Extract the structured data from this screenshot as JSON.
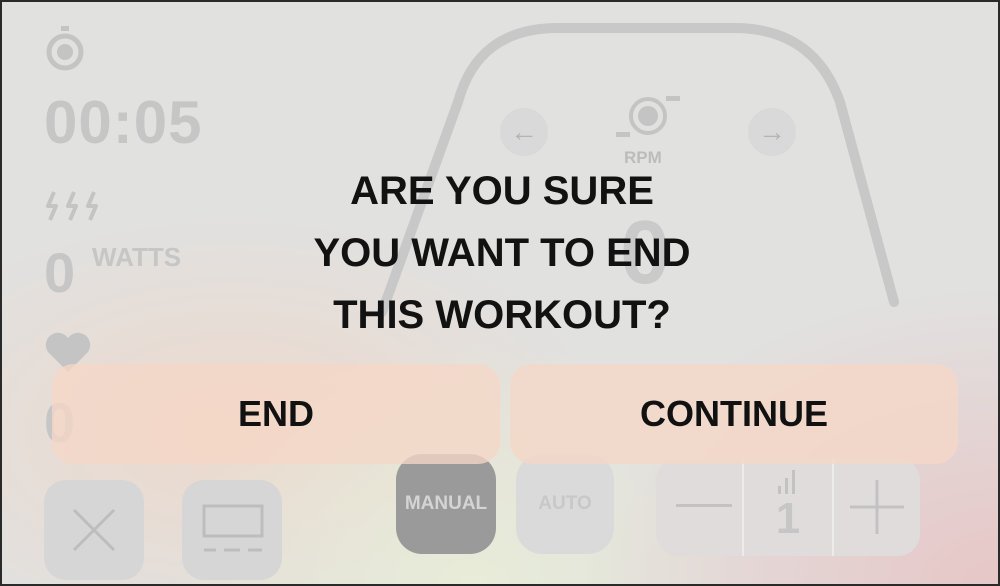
{
  "stats": {
    "elapsed_time": "00:05",
    "watts_value": "0",
    "watts_unit": "WATTS",
    "heart_rate_value": "0"
  },
  "cadence": {
    "label": "RPM",
    "value": "0"
  },
  "modes": {
    "manual": "MANUAL",
    "auto": "AUTO"
  },
  "resistance": {
    "level": "1"
  },
  "dialog": {
    "message_lines": [
      "ARE YOU SURE",
      "YOU WANT TO END",
      "THIS WORKOUT?"
    ],
    "end_label": "END",
    "continue_label": "CONTINUE"
  },
  "colors": {
    "dialog_button": "#f5d7c6",
    "dimmed_text": "#c6c6c6",
    "manual_active": "#9a9a9a"
  },
  "icons": [
    "stopwatch-icon",
    "power-bolts-icon",
    "heart-icon",
    "cadence-icon",
    "arrow-left-icon",
    "arrow-right-icon",
    "close-icon",
    "display-icon",
    "minus-icon",
    "plus-icon",
    "signal-bars-icon"
  ]
}
